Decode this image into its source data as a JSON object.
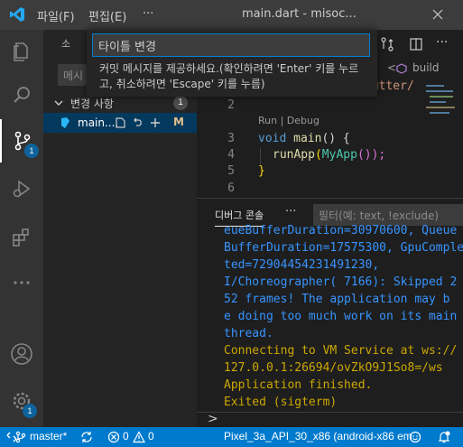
{
  "titlebar": {
    "menu": [
      "파일(F)",
      "편집(E)",
      "···"
    ],
    "title": "main.dart - misoc..."
  },
  "activity": {
    "scm_badge": "1",
    "settings_badge": "1"
  },
  "sidebar": {
    "header_partial": "소",
    "message_placeholder": "메시",
    "changes_label": "변경 사항",
    "changes_count": "1",
    "file_name": "main....",
    "file_status": "M"
  },
  "editor": {
    "breadcrumb_fn": "build",
    "breadcrumb_path": "lutter/",
    "codelens": "Run | Debug",
    "lines": [
      {
        "num": "2",
        "text": ""
      },
      {
        "num": "3",
        "kw": "void",
        "fn": "main",
        "rest": "() {"
      },
      {
        "num": "4",
        "fn": "runApp",
        "cls": "MyApp",
        "rest2": "());"
      },
      {
        "num": "5",
        "text": "}"
      },
      {
        "num": "6",
        "text": ""
      }
    ]
  },
  "panel": {
    "tab": "디버그 콘솔",
    "more": "···",
    "filter_placeholder": "필터(예: text, !exclude)",
    "output": [
      {
        "text": "eueBufferDuration=30970600, Queue",
        "color": "blue"
      },
      {
        "text": "BufferDuration=17575300, GpuComple",
        "color": "blue"
      },
      {
        "text": "ted=72904454231491230,",
        "color": "blue"
      },
      {
        "text": "I/Choreographer( 7166): Skipped 2",
        "color": "blue"
      },
      {
        "text": "52 frames!  The application may b",
        "color": "blue"
      },
      {
        "text": "e doing too much work on its main",
        "color": "blue"
      },
      {
        "text": "thread.",
        "color": "blue"
      },
      {
        "text": "Connecting to VM Service at ws://",
        "color": "orange"
      },
      {
        "text": "127.0.0.1:26694/ovZkO9J1So8=/ws",
        "color": "orange"
      },
      {
        "text": "Application finished.",
        "color": "orange"
      },
      {
        "text": "Exited (sigterm)",
        "color": "orange"
      }
    ],
    "prompt": ">"
  },
  "statusbar": {
    "branch": "master*",
    "errors": "0",
    "warnings": "0",
    "device": "Pixel_3a_API_30_x86 (android-x86 em"
  },
  "quick_input": {
    "value": "타이틀 변경",
    "message": "커밋 메시지를 제공하세요.(확인하려면 'Enter' 키를 누르고, 취소하려면 'Escape' 키를 누름)"
  },
  "colors": {
    "accent": "#007acc",
    "badge": "#0e639c",
    "console_blue": "#3794ff",
    "console_orange": "#cca700"
  }
}
